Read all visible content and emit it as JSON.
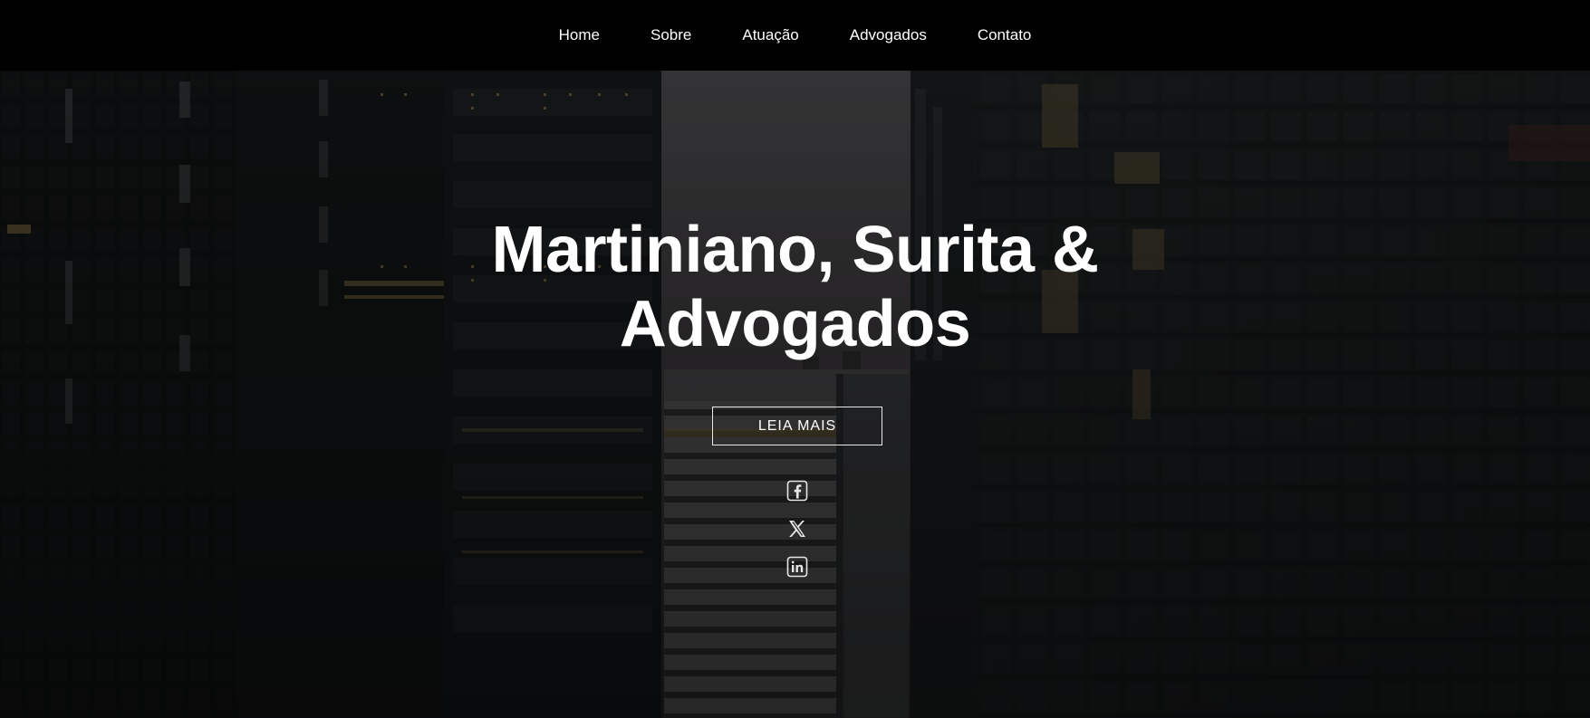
{
  "nav": {
    "items": [
      {
        "label": "Home"
      },
      {
        "label": "Sobre"
      },
      {
        "label": "Atuação"
      },
      {
        "label": "Advogados"
      },
      {
        "label": "Contato"
      }
    ]
  },
  "hero": {
    "title_line1": "Martiniano, Surita &",
    "title_line2": "Advogados",
    "cta_label": "LEIA MAIS",
    "background": "dark city skyscrapers photo"
  },
  "social": {
    "icons": [
      "facebook-icon",
      "x-twitter-icon",
      "linkedin-icon"
    ]
  },
  "colors": {
    "nav_bg": "#000000",
    "text": "#ffffff",
    "overlay": "#0d0f10"
  }
}
